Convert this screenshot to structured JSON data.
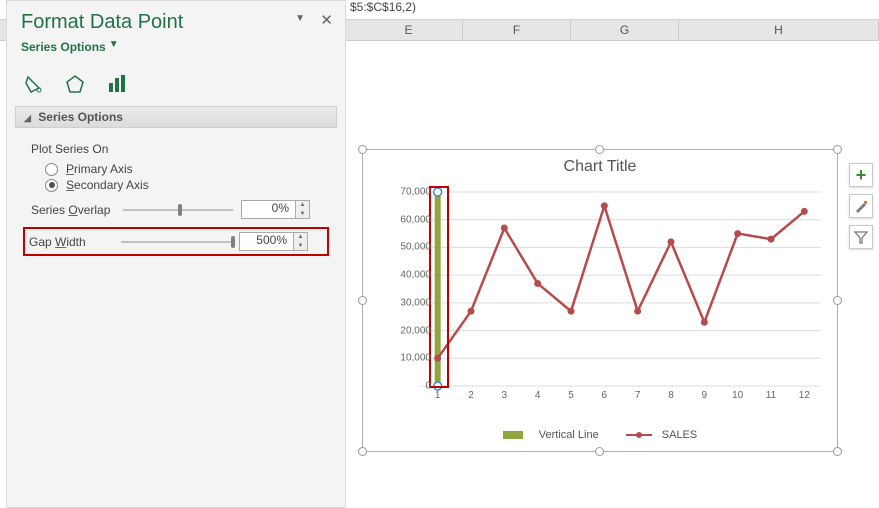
{
  "formula_fragment": "$5:$C$16,2)",
  "columns": {
    "E": "E",
    "F": "F",
    "G": "G",
    "H": "H"
  },
  "pane": {
    "title": "Format Data Point",
    "dropdown": "Series Options",
    "section": "Series Options",
    "plot_on": "Plot Series On",
    "primary": "Primary Axis",
    "secondary": "Secondary Axis",
    "overlap_label": "Series Overlap",
    "overlap_value": "0%",
    "gap_label": "Gap Width",
    "gap_value": "500%"
  },
  "chart": {
    "title": "Chart Title",
    "legend_bar": "Vertical Line",
    "legend_line": "SALES"
  },
  "chart_data": {
    "type": "combo",
    "title": "Chart Title",
    "xlabel": "",
    "ylabel": "",
    "ylim": [
      0,
      70000
    ],
    "yticks": [
      0,
      10000,
      20000,
      30000,
      40000,
      50000,
      60000,
      70000
    ],
    "categories": [
      1,
      2,
      3,
      4,
      5,
      6,
      7,
      8,
      9,
      10,
      11,
      12
    ],
    "series": [
      {
        "name": "Vertical Line",
        "type": "bar-secondary",
        "values": [
          70000,
          null,
          null,
          null,
          null,
          null,
          null,
          null,
          null,
          null,
          null,
          null
        ]
      },
      {
        "name": "SALES",
        "type": "line",
        "values": [
          10000,
          27000,
          57000,
          37000,
          27000,
          65000,
          27000,
          52000,
          23000,
          55000,
          53000,
          63000
        ]
      }
    ],
    "legend_position": "bottom",
    "grid": "horizontal"
  }
}
